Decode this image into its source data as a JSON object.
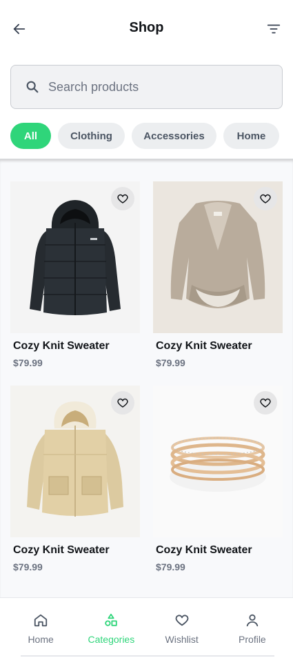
{
  "header": {
    "title": "Shop",
    "back_icon": "arrow-left-icon",
    "filter_icon": "filter-icon"
  },
  "search": {
    "placeholder": "Search products",
    "value": "",
    "icon": "search-icon"
  },
  "categories": {
    "items": [
      {
        "label": "All",
        "active": true
      },
      {
        "label": "Clothing",
        "active": false
      },
      {
        "label": "Accessories",
        "active": false
      },
      {
        "label": "Home",
        "active": false
      }
    ]
  },
  "products": [
    {
      "name": "Cozy Knit Sweater",
      "price": "$79.99",
      "image": "black puffer jacket",
      "favorite": false
    },
    {
      "name": "Cozy Knit Sweater",
      "price": "$79.99",
      "image": "beige knit cardigan",
      "favorite": false
    },
    {
      "name": "Cozy Knit Sweater",
      "price": "$79.99",
      "image": "cream hooded puffer jacket",
      "favorite": false
    },
    {
      "name": "Cozy Knit Sweater",
      "price": "$79.99",
      "image": "gold layered ring",
      "favorite": false
    }
  ],
  "bottom_nav": {
    "items": [
      {
        "label": "Home",
        "icon": "home-icon",
        "active": false
      },
      {
        "label": "Categories",
        "icon": "categories-icon",
        "active": true
      },
      {
        "label": "Wishlist",
        "icon": "heart-icon",
        "active": false
      },
      {
        "label": "Profile",
        "icon": "user-icon",
        "active": false
      }
    ]
  },
  "colors": {
    "accent": "#2fd57a",
    "text": "#111418",
    "muted": "#6b7280",
    "chip_bg": "#eceef0"
  }
}
